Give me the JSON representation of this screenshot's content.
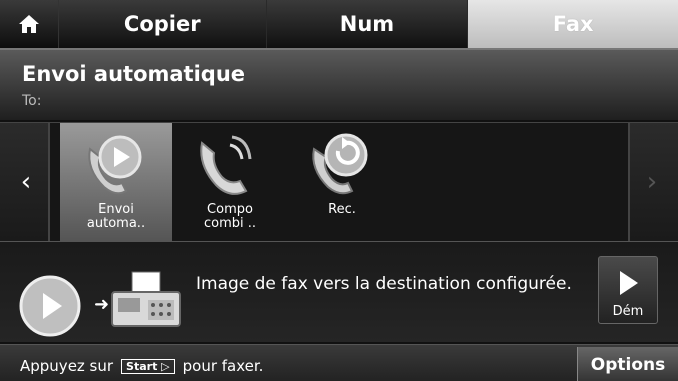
{
  "tabs": {
    "home_icon": "home-icon",
    "copier": "Copier",
    "num": "Num",
    "fax": "Fax",
    "active": "Fax"
  },
  "header": {
    "title": "Envoi automatique",
    "to_label": "To:"
  },
  "carousel": {
    "items": [
      {
        "label_line1": "Envoi",
        "label_line2": "automa..",
        "icon": "auto-send-icon",
        "selected": true
      },
      {
        "label_line1": "Compo",
        "label_line2": "combi ..",
        "icon": "phone-dial-icon",
        "selected": false
      },
      {
        "label_line1": "Rec.",
        "label_line2": "",
        "icon": "redial-icon",
        "selected": false
      }
    ]
  },
  "info": {
    "description": "Image de fax vers la destination configurée.",
    "start_button_label": "Dém"
  },
  "footer": {
    "hint_before": "Appuyez sur",
    "start_key": "Start ▷",
    "hint_after": "pour faxer.",
    "options_label": "Options"
  },
  "colors": {
    "background": "#111111",
    "active_tab": "#d5d5d5",
    "text": "#ffffff"
  }
}
